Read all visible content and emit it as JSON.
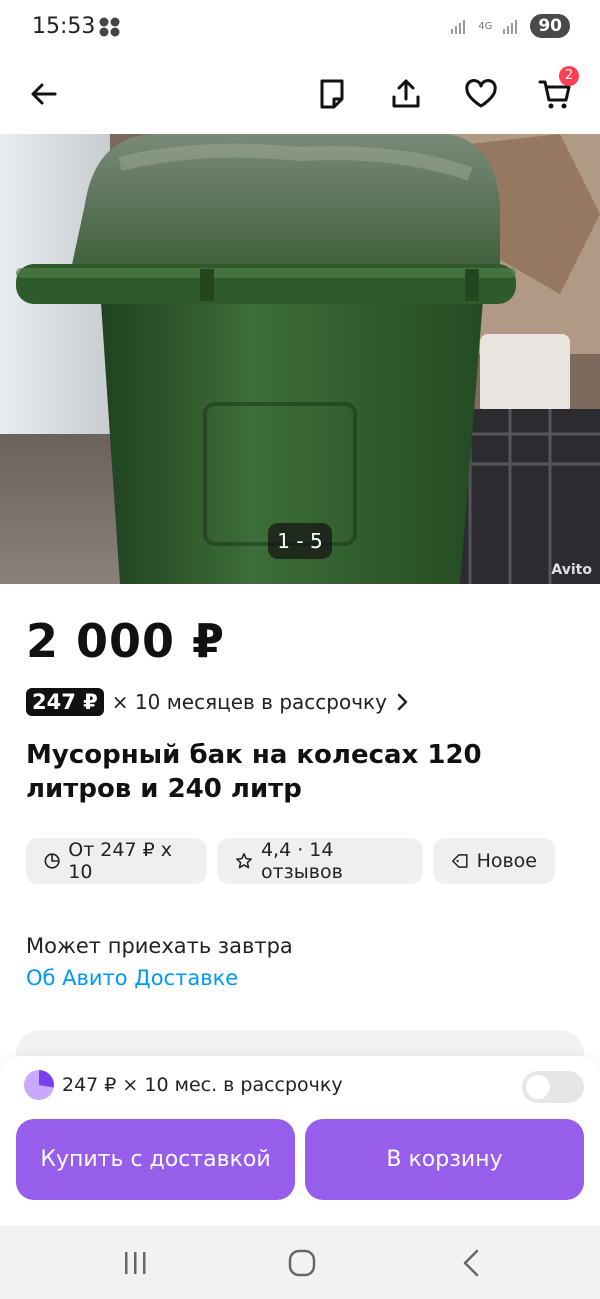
{
  "status_bar": {
    "time": "15:53",
    "network": "4G",
    "battery": "90"
  },
  "app_bar": {
    "cart_count": "2"
  },
  "gallery": {
    "counter": "1 - 5",
    "watermark": "Avito"
  },
  "listing": {
    "price": "2 000 ₽",
    "installment_amount": "247 ₽",
    "installment_text": "× 10 месяцев в рассрочку",
    "title": "Мусорный бак на колесах 120 литров и 240 литр"
  },
  "chips": [
    {
      "icon": "pie-clock-icon",
      "label": "От 247 ₽ х 10"
    },
    {
      "icon": "star-icon",
      "label": "4,4 · 14 отзывов"
    },
    {
      "icon": "tag-icon",
      "label": "Новое"
    }
  ],
  "delivery": {
    "line": "Может приехать завтра",
    "link": "Об Авито Доставке"
  },
  "bottom_sheet": {
    "split_text": "247 ₽ × 10 мес. в рассрочку",
    "toggle_on": false,
    "buy_label": "Купить с доставкой",
    "cart_label": "В корзину"
  },
  "colors": {
    "accent": "#965eeb",
    "link": "#0099f7",
    "badge": "#ff4053"
  }
}
